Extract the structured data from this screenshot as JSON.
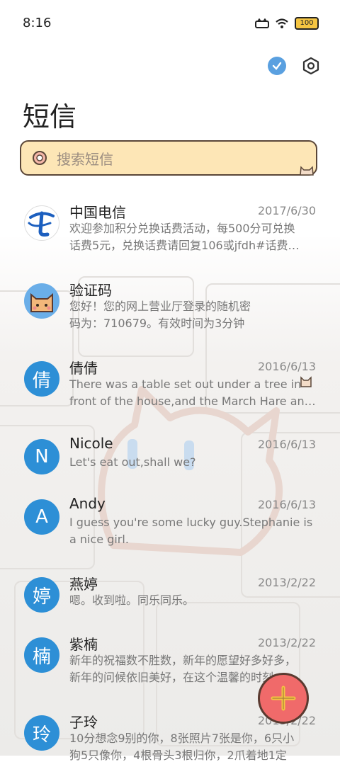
{
  "status_bar": {
    "time": "8:16",
    "battery": "100"
  },
  "header": {
    "title": "短信"
  },
  "search": {
    "placeholder": "搜索短信"
  },
  "conversations": [
    {
      "name": "中国电信",
      "date": "2017/6/30",
      "avatar": "",
      "line1": "欢迎参加积分兑换话费活动，每500分可兑换",
      "line2": "话费5元，兑换话费请回复106或jfdh#话费…"
    },
    {
      "name": "验证码",
      "date": "",
      "avatar": "",
      "line1": "您好！您的网上营业厅登录的随机密",
      "line2": "码为：710679。有效时间为3分钟"
    },
    {
      "name": "倩倩",
      "date": "2016/6/13",
      "avatar": "倩",
      "line1": "There was a table set out under a tree in",
      "line2": "front of the house,and the March Hare an…"
    },
    {
      "name": "Nicole",
      "date": "2016/6/13",
      "avatar": "N",
      "line1": "Let's eat out,shall we?",
      "line2": ""
    },
    {
      "name": "Andy",
      "date": "2016/6/13",
      "avatar": "A",
      "line1": "I guess you're some lucky guy.Stephanie is",
      "line2": "a nice girl."
    },
    {
      "name": "燕婷",
      "date": "2013/2/22",
      "avatar": "婷",
      "line1": "嗯。收到啦。同乐同乐。",
      "line2": ""
    },
    {
      "name": "紫楠",
      "date": "2013/2/22",
      "avatar": "楠",
      "line1": "新年的祝福数不胜数，新年的愿望好多好多，",
      "line2": "新年的问候依旧美好，在这个温馨的时刻…"
    },
    {
      "name": "子玲",
      "date": "2013/2/22",
      "avatar": "玲",
      "line1": "10分想念9别的你，8张照片7张是你，6只小",
      "line2": "狗5只像你，4根骨头3根归你，2爪着地1定"
    }
  ],
  "colors": {
    "accent": "#2d8fd6",
    "search_bg": "#fde6b6",
    "fab": "#f06a6a"
  },
  "icons": [
    "wifi-icon",
    "check-circle-icon",
    "settings-hex-icon",
    "search-icon",
    "add-icon"
  ]
}
